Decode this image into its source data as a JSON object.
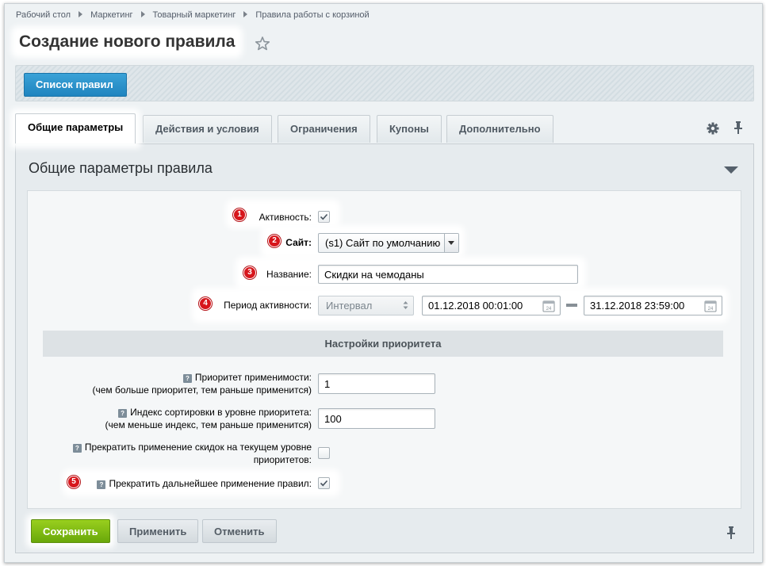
{
  "breadcrumbs": [
    "Рабочий стол",
    "Маркетинг",
    "Товарный маркетинг",
    "Правила работы с корзиной"
  ],
  "page": {
    "title": "Создание нового правила",
    "favorite_icon": "star-icon"
  },
  "toolbar": {
    "list_button": "Список правил"
  },
  "tabs": [
    {
      "label": "Общие параметры",
      "active": true
    },
    {
      "label": "Действия и условия"
    },
    {
      "label": "Ограничения"
    },
    {
      "label": "Купоны"
    },
    {
      "label": "Дополнительно"
    }
  ],
  "tab_icons": {
    "settings": "gear-icon",
    "pin": "pin-icon"
  },
  "section": {
    "title": "Общие параметры правила",
    "collapse_icon": "triangle-down-icon"
  },
  "form": {
    "active": {
      "badge": "1",
      "label": "Активность:",
      "checked": true
    },
    "site": {
      "badge": "2",
      "label": "Сайт:",
      "value": "(s1) Сайт по умолчанию"
    },
    "name": {
      "badge": "3",
      "label": "Название:",
      "value": "Скидки на чемоданы"
    },
    "period": {
      "badge": "4",
      "label": "Период активности:",
      "type": "Интервал",
      "from": "01.12.2018 00:01:00",
      "to": "31.12.2018 23:59:00"
    }
  },
  "priority": {
    "heading": "Настройки приоритета",
    "applicability": {
      "label_1": "Приоритет применимости:",
      "label_2": "(чем больше приоритет, тем раньше применится)",
      "value": "1"
    },
    "sort": {
      "label_1": "Индекс сортировки в уровне приоритета:",
      "label_2": "(чем меньше индекс, тем раньше применится)",
      "value": "100"
    },
    "stop_level": {
      "label_1": "Прекратить применение скидок на текущем уровне",
      "label_2": "приоритетов:",
      "checked": false
    },
    "stop_further": {
      "badge": "5",
      "label": "Прекратить дальнейшее применение правил:",
      "checked": true
    }
  },
  "buttons": {
    "save": "Сохранить",
    "apply": "Применить",
    "cancel": "Отменить"
  },
  "colors": {
    "save_green": "#7ab813",
    "list_blue": "#2b93cb",
    "badge_red": "#d7161c"
  }
}
